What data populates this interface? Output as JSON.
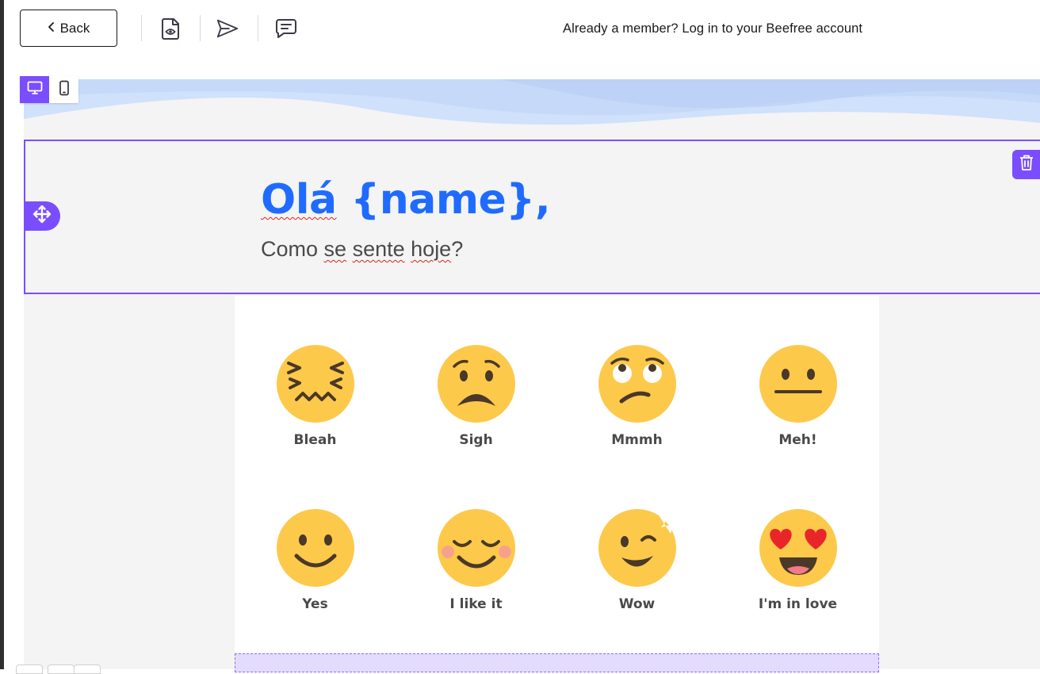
{
  "toolbar": {
    "back_label": "Back",
    "icons": [
      "preview-icon",
      "send-icon",
      "comment-icon"
    ],
    "login_prompt": "Already a member? Log in to your Beefree account"
  },
  "device_toggle": {
    "active": "desktop",
    "options": [
      "desktop-icon",
      "mobile-icon"
    ]
  },
  "header": {
    "greeting": "Olá {name},",
    "greeting_parts": {
      "word": "Olá",
      "rest": " {name},"
    },
    "question": "Como se sente hoje?",
    "question_parts": {
      "p1": "Como ",
      "w1": "se",
      "p2": " ",
      "w2": "sente",
      "p3": " ",
      "w3": "hoje",
      "p4": "?"
    }
  },
  "emojis": [
    {
      "label": "Bleah",
      "icon": "confounded-face-icon"
    },
    {
      "label": "Sigh",
      "icon": "worried-face-icon"
    },
    {
      "label": "Mmmh",
      "icon": "eye-roll-face-icon"
    },
    {
      "label": "Meh!",
      "icon": "neutral-face-icon"
    },
    {
      "label": "Yes",
      "icon": "smile-face-icon"
    },
    {
      "label": "I like it",
      "icon": "blush-face-icon"
    },
    {
      "label": "Wow",
      "icon": "wink-face-icon"
    },
    {
      "label": "I'm in love",
      "icon": "heart-eyes-face-icon"
    }
  ],
  "colors": {
    "accent": "#7a4dff",
    "heading": "#1f6bff",
    "emoji_face": "#fdc94a",
    "emoji_feature": "#5a4430",
    "drop_zone": "#e4dcff"
  }
}
